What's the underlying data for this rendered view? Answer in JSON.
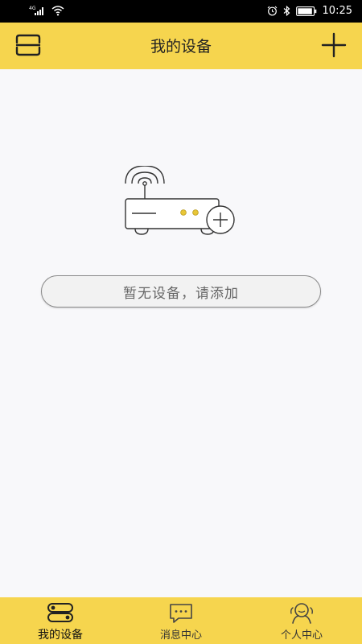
{
  "status_bar": {
    "network": "4G",
    "time": "10:25"
  },
  "header": {
    "title": "我的设备",
    "menu_icon": "scan-menu-icon",
    "add_icon": "plus-icon"
  },
  "empty_state": {
    "illustration": "router-add-icon",
    "message": "暂无设备，请添加"
  },
  "tabs": [
    {
      "label": "我的设备",
      "icon": "device-icon",
      "active": true
    },
    {
      "label": "消息中心",
      "icon": "message-icon",
      "active": false
    },
    {
      "label": "个人中心",
      "icon": "person-icon",
      "active": false
    }
  ],
  "colors": {
    "accent": "#f6d54e",
    "background": "#f8f8fa"
  }
}
